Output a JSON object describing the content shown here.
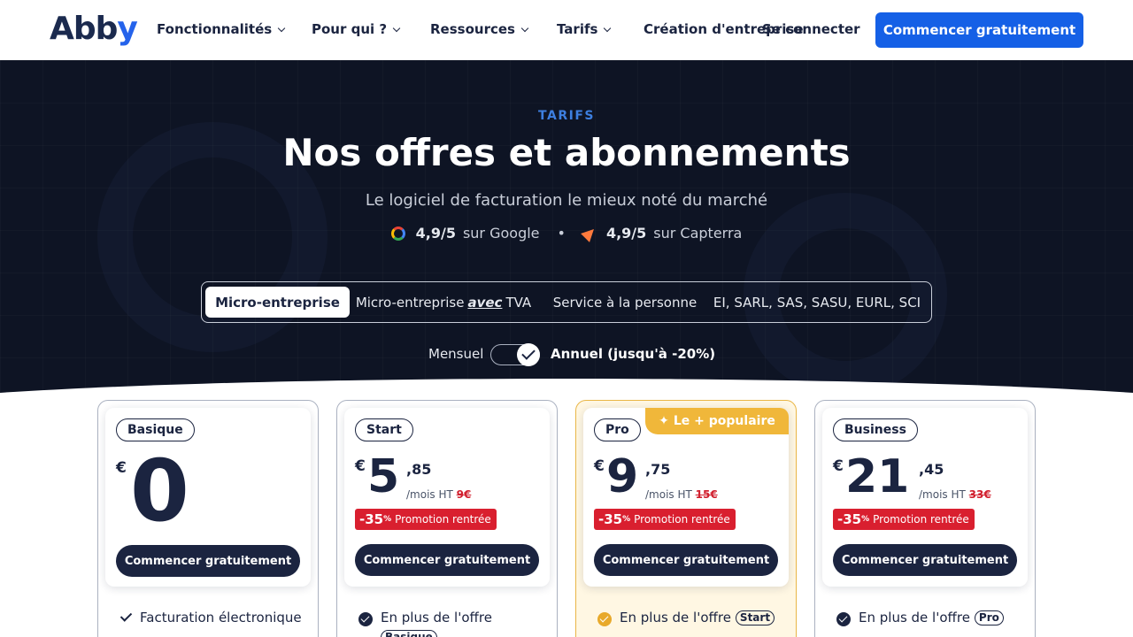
{
  "nav": {
    "logo_main": "Abb",
    "logo_accent": "y",
    "items": [
      {
        "label": "Fonctionnalités"
      },
      {
        "label": "Pour qui ?"
      },
      {
        "label": "Ressources"
      },
      {
        "label": "Tarifs"
      },
      {
        "label": "Création d'entreprise"
      }
    ],
    "login": "Se connecter",
    "cta": "Commencer gratuitement"
  },
  "hero": {
    "eyebrow": "TARIFS",
    "title": "Nos offres et abonnements",
    "subtitle": "Le logiciel de facturation le mieux noté du marché",
    "google_score": "4,9/5",
    "google_label": "sur Google",
    "separator": "•",
    "capterra_score": "4,9/5",
    "capterra_label": "sur Capterra"
  },
  "segments": {
    "s1": "Micro-entreprise",
    "s2_pre": "Micro-entreprise",
    "s2_em": "avec",
    "s2_post": "TVA",
    "s3": "Service à la personne",
    "s4": "EI, SARL, SAS, SASU, EURL, SCI",
    "active_index": 0
  },
  "billing": {
    "monthly": "Mensuel",
    "annual": "Annuel (jusqu'à -20%)",
    "annual_selected": true
  },
  "plans": [
    {
      "name": "Basique",
      "currency": "€",
      "price": "0",
      "cta": "Commencer gratuitement",
      "feature": "Facturation électronique"
    },
    {
      "name": "Start",
      "currency": "€",
      "price": "5",
      "cents": ",85",
      "per": "/mois HT",
      "old": "9€",
      "discount": "-35",
      "discount_sup": "%",
      "promo": "Promotion rentrée",
      "cta": "Commencer gratuitement",
      "feature": "En plus de l'offre",
      "feature_pill": "Basique"
    },
    {
      "name": "Pro",
      "popular": "Le + populaire",
      "currency": "€",
      "price": "9",
      "cents": ",75",
      "per": "/mois HT",
      "old": "15€",
      "discount": "-35",
      "discount_sup": "%",
      "promo": "Promotion rentrée",
      "cta": "Commencer gratuitement",
      "feature": "En plus de l'offre",
      "feature_pill": "Start"
    },
    {
      "name": "Business",
      "currency": "€",
      "price": "21",
      "cents": ",45",
      "per": "/mois HT",
      "old": "33€",
      "discount": "-35",
      "discount_sup": "%",
      "promo": "Promotion rentrée",
      "cta": "Commencer gratuitement",
      "feature": "En plus de l'offre",
      "feature_pill": "Pro"
    }
  ],
  "colors": {
    "brand": "#1560e6",
    "navy": "#1b2440",
    "hero_bg": "#0e1424",
    "promo_red": "#d91f2f",
    "popular_gold": "#f0b73a"
  }
}
